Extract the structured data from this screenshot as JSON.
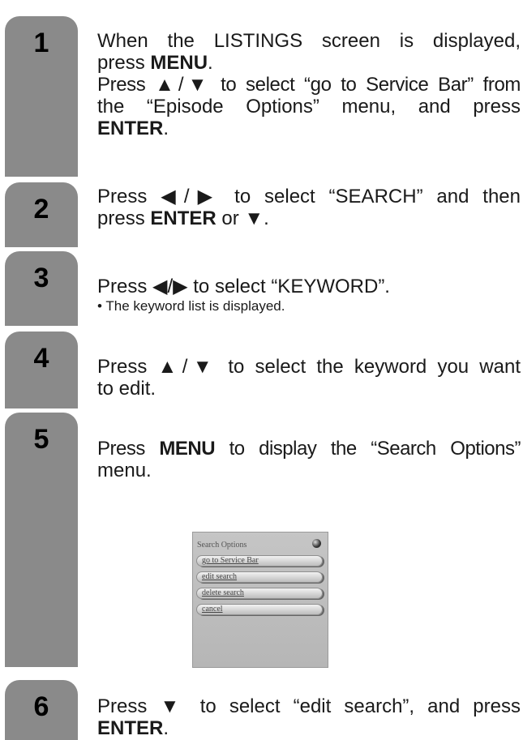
{
  "steps": [
    {
      "number": "1",
      "lines": [
        "When the LISTINGS screen is displayed,",
        "press ",
        "MENU",
        ".",
        "Press ▲/▼ to select “go to Service Bar” from",
        "the “Episode Options” menu, and press",
        "ENTER",
        "."
      ]
    },
    {
      "number": "2",
      "line1": "Press ◀/▶ to select “SEARCH” and then",
      "line2_pre": "press ",
      "line2_bold": "ENTER",
      "line2_post": " or ▼."
    },
    {
      "number": "3",
      "line1": "Press ◀/▶ to select “KEYWORD”.",
      "note": "• The keyword list is displayed."
    },
    {
      "number": "4",
      "line1": "Press ▲/▼ to select the keyword you want",
      "line2": "to edit."
    },
    {
      "number": "5",
      "line1_pre": "Press ",
      "line1_bold": "MENU",
      "line1_post": " to display the “Search Options”",
      "line2": "menu."
    },
    {
      "number": "6",
      "line1": "Press ▼ to select “edit search”, and press",
      "line2_bold": "ENTER",
      "line2_post": "."
    }
  ],
  "search_options_menu": {
    "title": "Search Options",
    "items": [
      "go to Service Bar",
      "edit search",
      "delete search",
      "cancel"
    ]
  }
}
